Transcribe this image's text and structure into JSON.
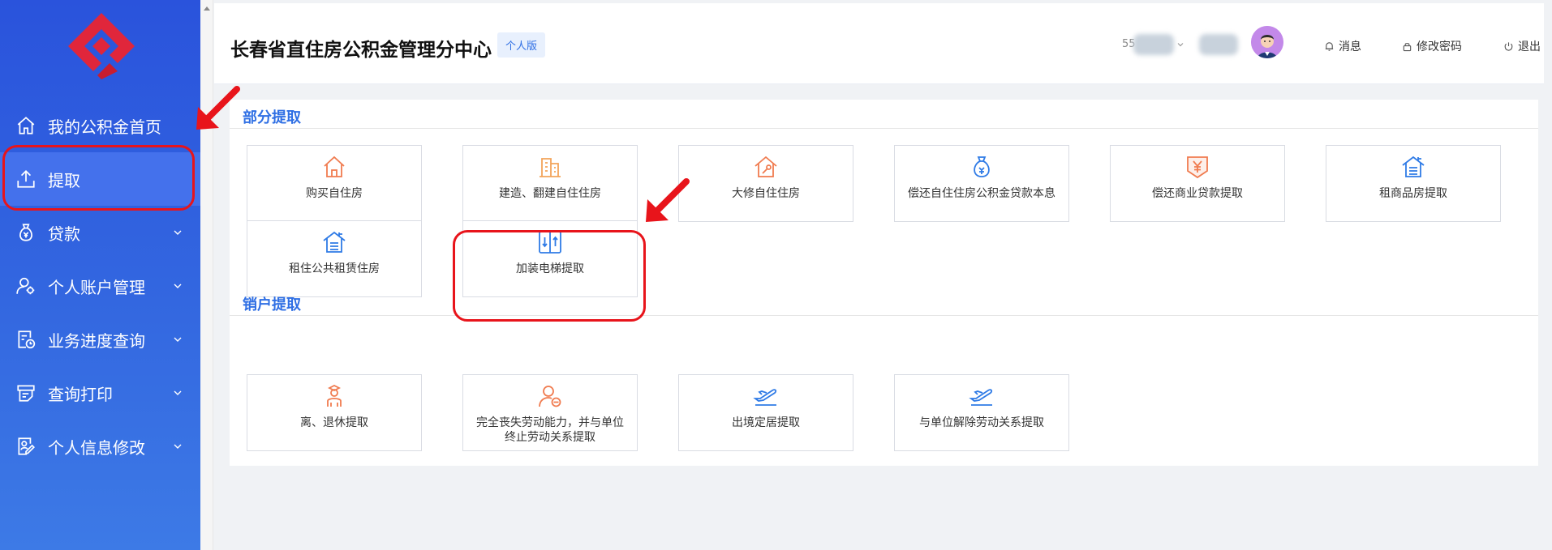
{
  "sidebar": {
    "items": [
      {
        "label": "我的公积金首页",
        "icon": "home-icon",
        "has_submenu": false,
        "active": false
      },
      {
        "label": "提取",
        "icon": "upload-icon",
        "has_submenu": false,
        "active": true
      },
      {
        "label": "贷款",
        "icon": "money-bag-icon",
        "has_submenu": true,
        "active": false
      },
      {
        "label": "个人账户管理",
        "icon": "user-settings-icon",
        "has_submenu": true,
        "active": false
      },
      {
        "label": "业务进度查询",
        "icon": "document-clock-icon",
        "has_submenu": true,
        "active": false
      },
      {
        "label": "查询打印",
        "icon": "printer-icon",
        "has_submenu": true,
        "active": false
      },
      {
        "label": "个人信息修改",
        "icon": "edit-profile-icon",
        "has_submenu": true,
        "active": false
      }
    ]
  },
  "header": {
    "title": "长春省直住房公积金管理分中心",
    "edition": "个人版",
    "account_partial": "55",
    "messages": "消息",
    "change_password": "修改密码",
    "logout": "退出"
  },
  "sections": [
    {
      "title": "部分提取",
      "cards": [
        {
          "label": "购买自住房",
          "icon": "house-icon",
          "color": "#f07b4f"
        },
        {
          "label": "建造、翻建自住住房",
          "icon": "building-icon",
          "color": "#f3a45a"
        },
        {
          "label": "大修自住住房",
          "icon": "house-repair-icon",
          "color": "#f07b4f"
        },
        {
          "label": "偿还自住住房公积金贷款本息",
          "icon": "money-bag-icon",
          "color": "#2f7be6"
        },
        {
          "label": "偿还商业贷款提取",
          "icon": "yen-shield-icon",
          "color": "#f07b4f"
        },
        {
          "label": "租商品房提取",
          "icon": "rent-house-icon",
          "color": "#2f7be6"
        },
        {
          "label": "租住公共租赁住房",
          "icon": "rent-house-icon",
          "color": "#2f7be6"
        },
        {
          "label": "加装电梯提取",
          "icon": "elevator-icon",
          "color": "#2f7be6"
        }
      ]
    },
    {
      "title": "销户提取",
      "cards": [
        {
          "label": "离、退休提取",
          "icon": "retiree-icon",
          "color": "#f07b4f"
        },
        {
          "label": "完全丧失劳动能力，并与单位终止劳动关系提取",
          "icon": "disabled-user-icon",
          "color": "#f07b4f"
        },
        {
          "label": "出境定居提取",
          "icon": "plane-icon",
          "color": "#2f7be6"
        },
        {
          "label": "与单位解除劳动关系提取",
          "icon": "plane-icon",
          "color": "#2f7be6"
        }
      ]
    }
  ],
  "colors": {
    "sidebar": "#2a53dc",
    "accent": "#2f6fe4",
    "annotation": "#e8141b"
  }
}
